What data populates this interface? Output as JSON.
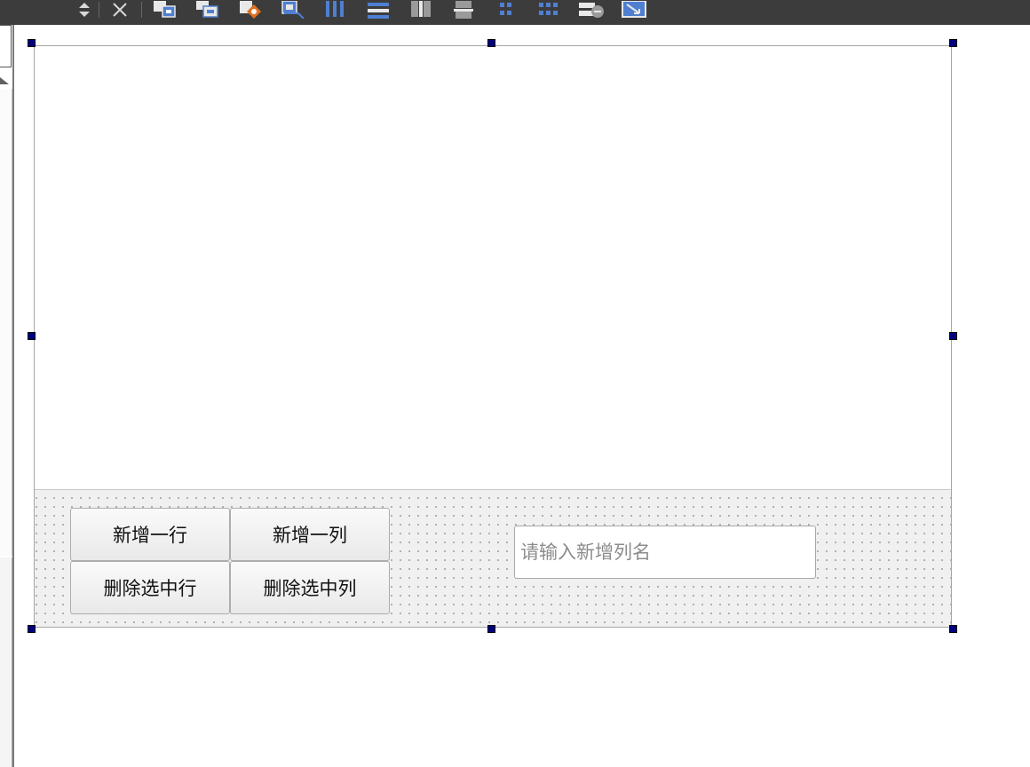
{
  "toolbar": {
    "icons": [
      "sort-updown-icon",
      "close-x-icon",
      "widget-box-icon",
      "widget-group-icon",
      "edit-tab-order-icon",
      "edit-buddies-icon",
      "layout-horizontal-icon",
      "layout-vertical-icon",
      "layout-hsplitter-icon",
      "layout-vsplitter-icon",
      "layout-form-icon",
      "layout-grid-icon",
      "break-layout-icon",
      "adjust-size-icon"
    ]
  },
  "form": {
    "buttons": {
      "add_row": "新增一行",
      "add_column": "新增一列",
      "delete_row": "删除选中行",
      "delete_column": "删除选中列"
    },
    "new_column_input": {
      "value": "",
      "placeholder": "请输入新增列名"
    }
  },
  "colors": {
    "toolbar_bg": "#3c3c3c",
    "handle": "#000080",
    "panel_bg": "#f0f0f0"
  }
}
